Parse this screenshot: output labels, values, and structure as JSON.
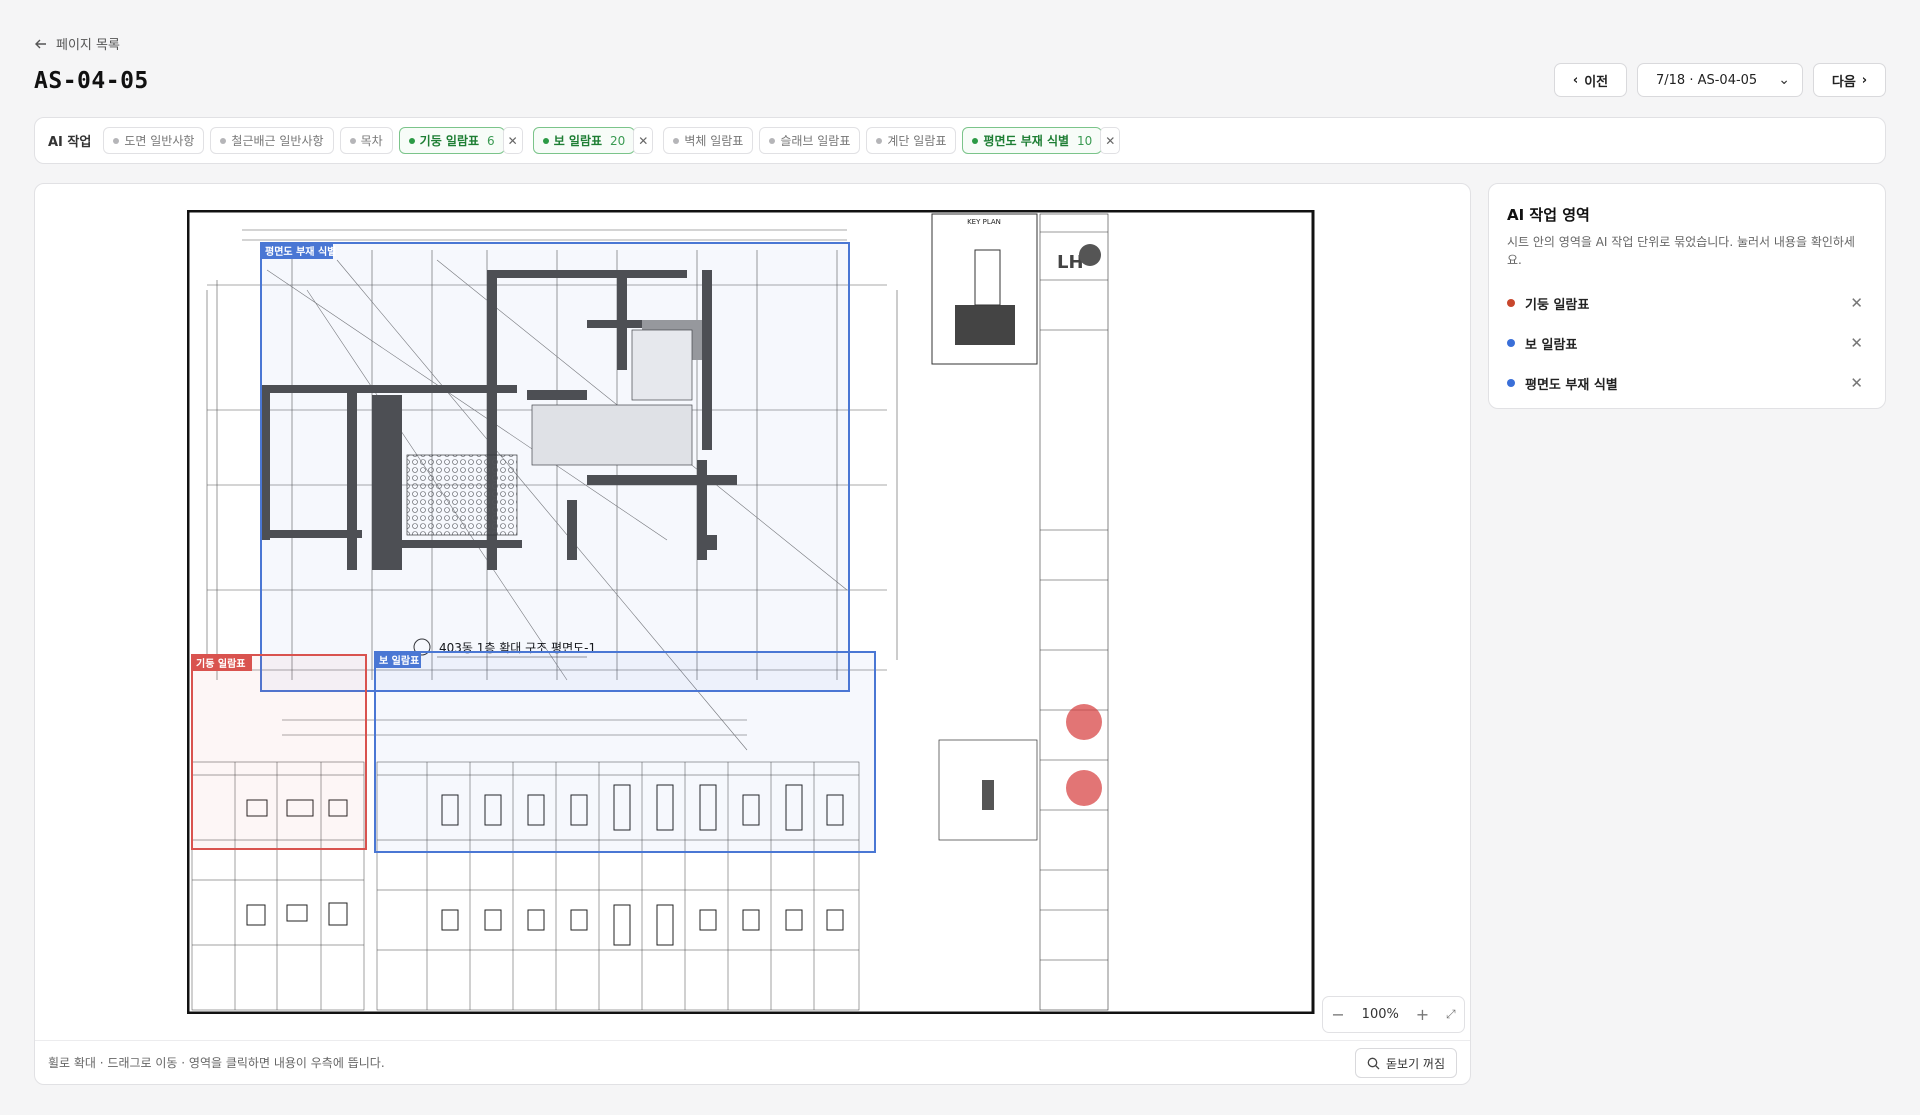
{
  "header": {
    "back_label": "페이지 목록",
    "title": "AS-04-05",
    "prev_label": "이전",
    "page_select": "7/18 · AS-04-05",
    "next_label": "다음"
  },
  "ai_bar": {
    "label": "AI 작업",
    "chips": [
      {
        "label": "도면 일반사항",
        "active": false
      },
      {
        "label": "철근배근 일반사항",
        "active": false
      },
      {
        "label": "목차",
        "active": false
      },
      {
        "label": "기둥 일람표",
        "count": "6",
        "active": true
      },
      {
        "label": "보 일람표",
        "count": "20",
        "active": true
      },
      {
        "label": "벽체 일람표",
        "active": false
      },
      {
        "label": "슬래브 일람표",
        "active": false
      },
      {
        "label": "계단 일람표",
        "active": false
      },
      {
        "label": "평면도 부재 식별",
        "count": "10",
        "active": true
      }
    ]
  },
  "viewer": {
    "region_labels": {
      "plan": "평면도 부재 식별",
      "column": "기둥 일람표",
      "beam": "보 일람표"
    },
    "drawing_title": "403동 1층 확대 구조 평면도-1",
    "key_plan_label": "KEY PLAN",
    "zoom": "100%",
    "footer_hint": "휠로 확대 · 드래그로 이동 · 영역을 클릭하면 내용이 우측에 뜹니다.",
    "preview_label": "돋보기 꺼짐",
    "colors": {
      "red_region": "#d9534f",
      "blue_region": "#4a77d4"
    }
  },
  "side_panel": {
    "title": "AI 작업 영역",
    "description": "시트 안의 영역을 AI 작업 단위로 묶었습니다. 눌러서 내용을 확인하세요.",
    "items": [
      {
        "label": "기둥 일람표",
        "color": "#c8472d"
      },
      {
        "label": "보 일람표",
        "color": "#3a6fd8"
      },
      {
        "label": "평면도 부재 식별",
        "color": "#3a6fd8"
      }
    ]
  }
}
